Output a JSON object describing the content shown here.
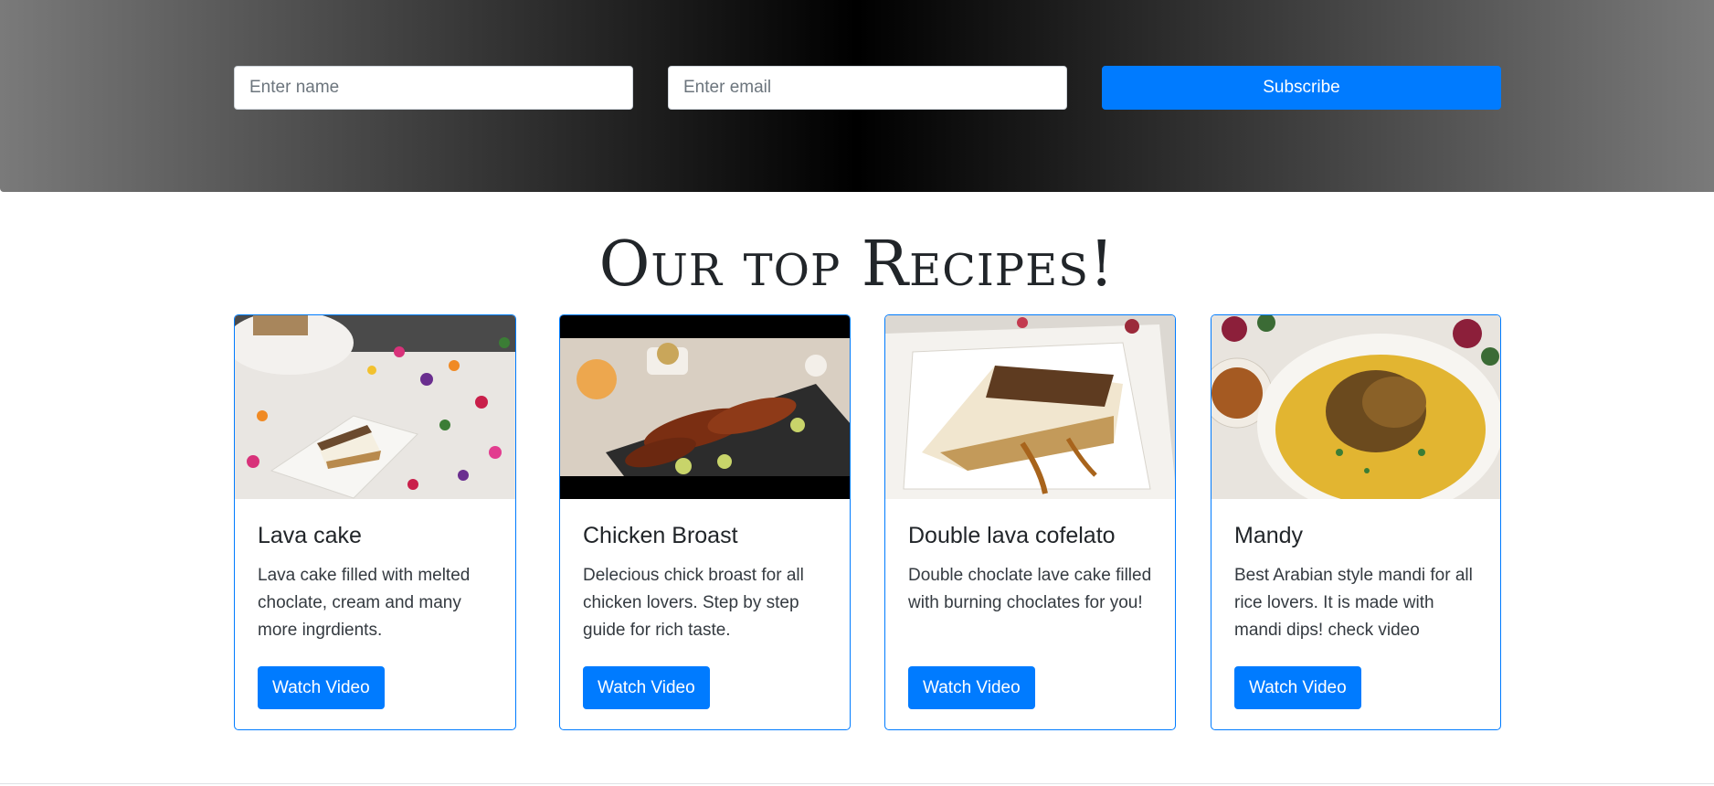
{
  "subscribe_form": {
    "name_placeholder": "Enter name",
    "email_placeholder": "Enter email",
    "button_label": "Subscribe"
  },
  "recipes_section": {
    "title": "Our top Recipes!",
    "cards": [
      {
        "title": "Lava cake",
        "description": "Lava cake filled with melted choclate, cream and many more ingrdients.",
        "button_label": "Watch Video",
        "image": "lava-cake-photo"
      },
      {
        "title": "Chicken Broast",
        "description": "Delecious chick broast for all chicken lovers. Step by step guide for rich taste.",
        "button_label": "Watch Video",
        "image": "chicken-broast-photo"
      },
      {
        "title": "Double lava cofelato",
        "description": "Double choclate lave cake filled with burning choclates for you!",
        "button_label": "Watch Video",
        "image": "double-lava-cofelato-photo"
      },
      {
        "title": "Mandy",
        "description": "Best Arabian style mandi for all rice lovers. It is made with mandi dips! check video",
        "button_label": "Watch Video",
        "image": "mandy-photo"
      }
    ]
  },
  "colors": {
    "primary": "#007bff",
    "hero_dark": "#000000",
    "hero_light": "#7a7a7a"
  }
}
